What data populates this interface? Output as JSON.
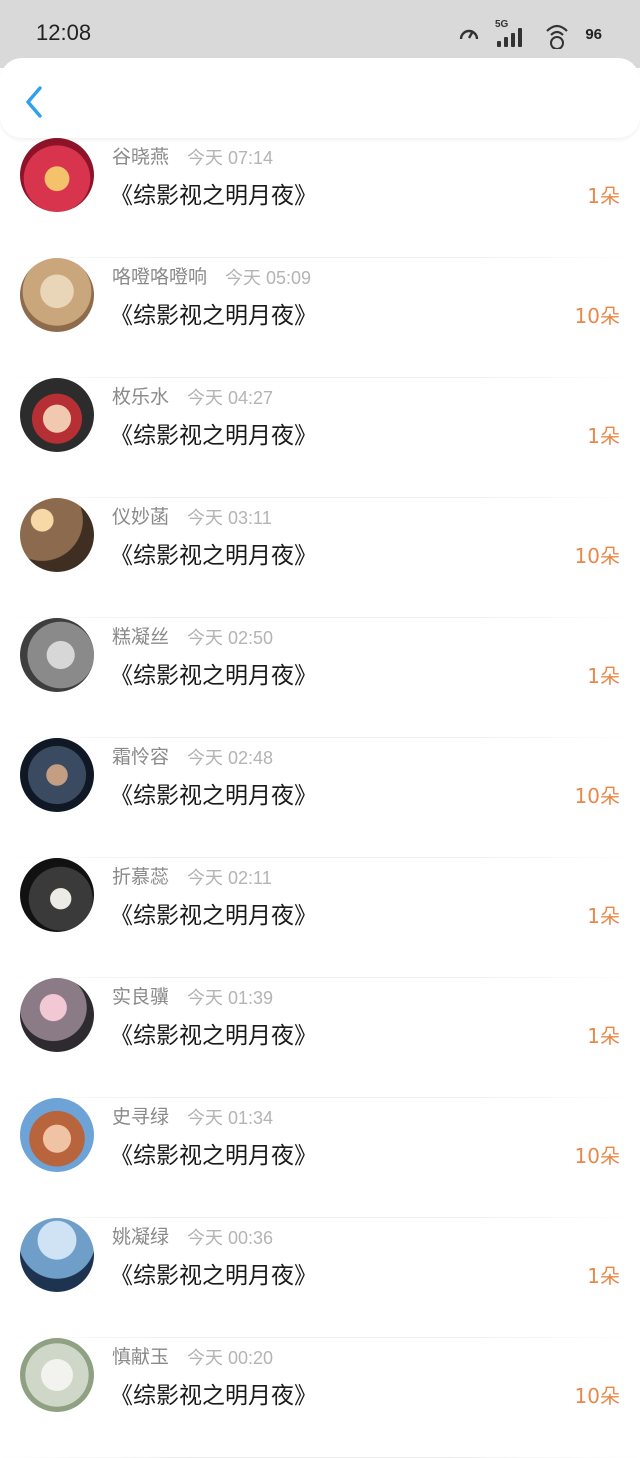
{
  "status_bar": {
    "time": "12:08",
    "network": "5G",
    "battery": "96"
  },
  "colors": {
    "accent_back": "#2f9ff0",
    "count_orange": "#e8894a"
  },
  "items": [
    {
      "name": "谷晓燕",
      "time": "今天 07:14",
      "title": "《综影视之明月夜》",
      "count": "1朵",
      "avatar": "cartoon-red"
    },
    {
      "name": "咯噔咯噔响",
      "time": "今天 05:09",
      "title": "《综影视之明月夜》",
      "count": "10朵",
      "avatar": "cat"
    },
    {
      "name": "枚乐水",
      "time": "今天 04:27",
      "title": "《综影视之明月夜》",
      "count": "1朵",
      "avatar": "cartoon-dark"
    },
    {
      "name": "仪妙菡",
      "time": "今天 03:11",
      "title": "《综影视之明月夜》",
      "count": "10朵",
      "avatar": "photo-warm"
    },
    {
      "name": "糕凝丝",
      "time": "今天 02:50",
      "title": "《综影视之明月夜》",
      "count": "1朵",
      "avatar": "photo-grey"
    },
    {
      "name": "霜怜容",
      "time": "今天 02:48",
      "title": "《综影视之明月夜》",
      "count": "10朵",
      "avatar": "photo-dark-blue"
    },
    {
      "name": "折慕蕊",
      "time": "今天 02:11",
      "title": "《综影视之明月夜》",
      "count": "1朵",
      "avatar": "photo-black"
    },
    {
      "name": "实良骥",
      "time": "今天 01:39",
      "title": "《综影视之明月夜》",
      "count": "1朵",
      "avatar": "photo-pink"
    },
    {
      "name": "史寻绿",
      "time": "今天 01:34",
      "title": "《综影视之明月夜》",
      "count": "10朵",
      "avatar": "cartoon-blue"
    },
    {
      "name": "姚凝绿",
      "time": "今天 00:36",
      "title": "《综影视之明月夜》",
      "count": "1朵",
      "avatar": "photo-sky"
    },
    {
      "name": "慎献玉",
      "time": "今天 00:20",
      "title": "《综影视之明月夜》",
      "count": "10朵",
      "avatar": "photo-light"
    }
  ]
}
